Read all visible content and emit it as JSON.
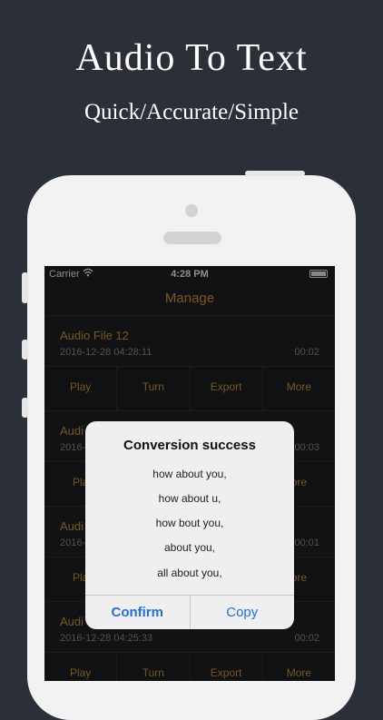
{
  "hero": {
    "title": "Audio To Text",
    "subtitle": "Quick/Accurate/Simple"
  },
  "status_bar": {
    "carrier": "Carrier",
    "time": "4:28 PM"
  },
  "nav": {
    "title": "Manage"
  },
  "files": [
    {
      "name": "Audio File 12",
      "date": "2016-12-28 04:28:11",
      "duration": "00:02",
      "actions": [
        "Play",
        "Turn",
        "Export",
        "More"
      ]
    },
    {
      "name": "Audi",
      "date": "2016-",
      "duration": "00:03",
      "actions": [
        "Pla",
        "ore"
      ]
    },
    {
      "name": "Audi",
      "date": "2016-",
      "duration": "00:01",
      "actions": [
        "Pla",
        "ore"
      ]
    },
    {
      "name": "Audi",
      "date": "2016-12-28 04:25:33",
      "duration": "00:02",
      "actions": [
        "Play",
        "Turn",
        "Export",
        "More"
      ]
    }
  ],
  "alert": {
    "title": "Conversion success",
    "lines": [
      "how about you,",
      "how about u,",
      "how bout you,",
      "about you,",
      "all about you,"
    ],
    "confirm_label": "Confirm",
    "copy_label": "Copy"
  },
  "colors": {
    "background": "#2b2f37",
    "accent": "#b8862f",
    "button_blue": "#1f6fe5"
  }
}
